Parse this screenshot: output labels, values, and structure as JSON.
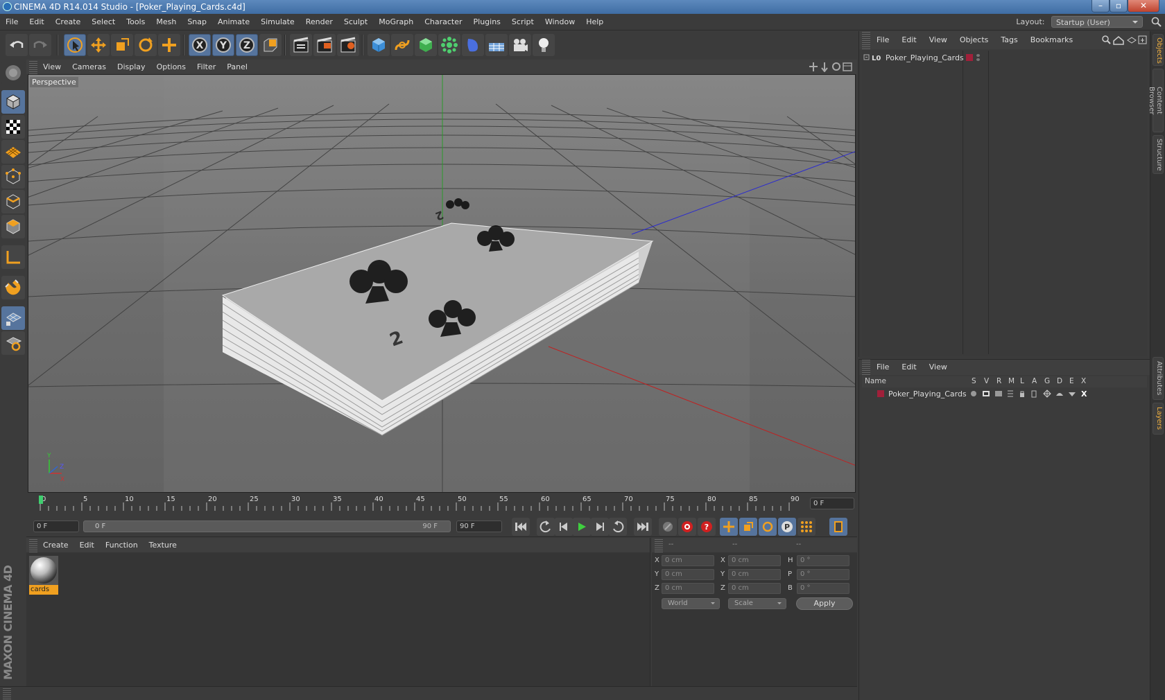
{
  "window": {
    "title": "CINEMA 4D R14.014 Studio - [Poker_Playing_Cards.c4d]",
    "minimize": "–",
    "maximize": "▫",
    "close": "✕"
  },
  "menubar": {
    "items": [
      "File",
      "Edit",
      "Create",
      "Select",
      "Tools",
      "Mesh",
      "Snap",
      "Animate",
      "Simulate",
      "Render",
      "Sculpt",
      "MoGraph",
      "Character",
      "Plugins",
      "Script",
      "Window",
      "Help"
    ],
    "layout_label": "Layout:",
    "layout_value": "Startup (User)"
  },
  "viewport": {
    "menu": [
      "View",
      "Cameras",
      "Display",
      "Options",
      "Filter",
      "Panel"
    ],
    "label": "Perspective"
  },
  "timeline": {
    "ticks": [
      "0",
      "5",
      "10",
      "15",
      "20",
      "25",
      "30",
      "35",
      "40",
      "45",
      "50",
      "55",
      "60",
      "65",
      "70",
      "75",
      "80",
      "85",
      "90"
    ],
    "current_frame": "0 F",
    "start_field": "0 F",
    "range_start": "0 F",
    "range_end": "90 F",
    "end_field": "90 F"
  },
  "material_panel": {
    "menu": [
      "Create",
      "Edit",
      "Function",
      "Texture"
    ],
    "material_name": "cards"
  },
  "coord_panel": {
    "header": [
      "--",
      "--",
      "--"
    ],
    "rows": [
      {
        "l1": "X",
        "v1": "0 cm",
        "l2": "X",
        "v2": "0 cm",
        "l3": "H",
        "v3": "0 °"
      },
      {
        "l1": "Y",
        "v1": "0 cm",
        "l2": "Y",
        "v2": "0 cm",
        "l3": "P",
        "v3": "0 °"
      },
      {
        "l1": "Z",
        "v1": "0 cm",
        "l2": "Z",
        "v2": "0 cm",
        "l3": "B",
        "v3": "0 °"
      }
    ],
    "space": "World",
    "mode": "Scale",
    "apply": "Apply"
  },
  "object_manager": {
    "menu": [
      "File",
      "Edit",
      "View",
      "Objects",
      "Tags",
      "Bookmarks"
    ],
    "object_name": "Poker_Playing_Cards"
  },
  "layer_manager": {
    "menu": [
      "File",
      "Edit",
      "View"
    ],
    "columns": [
      "Name",
      "S",
      "V",
      "R",
      "M",
      "L",
      "A",
      "G",
      "D",
      "E",
      "X"
    ],
    "layer_name": "Poker_Playing_Cards"
  },
  "side_tabs": [
    "Objects",
    "Content Browser",
    "Structure",
    "Attributes",
    "Layers"
  ],
  "colors": {
    "accent_orange": "#f0a020",
    "selection_blue": "#56749d",
    "layer_red": "#a0203a"
  }
}
